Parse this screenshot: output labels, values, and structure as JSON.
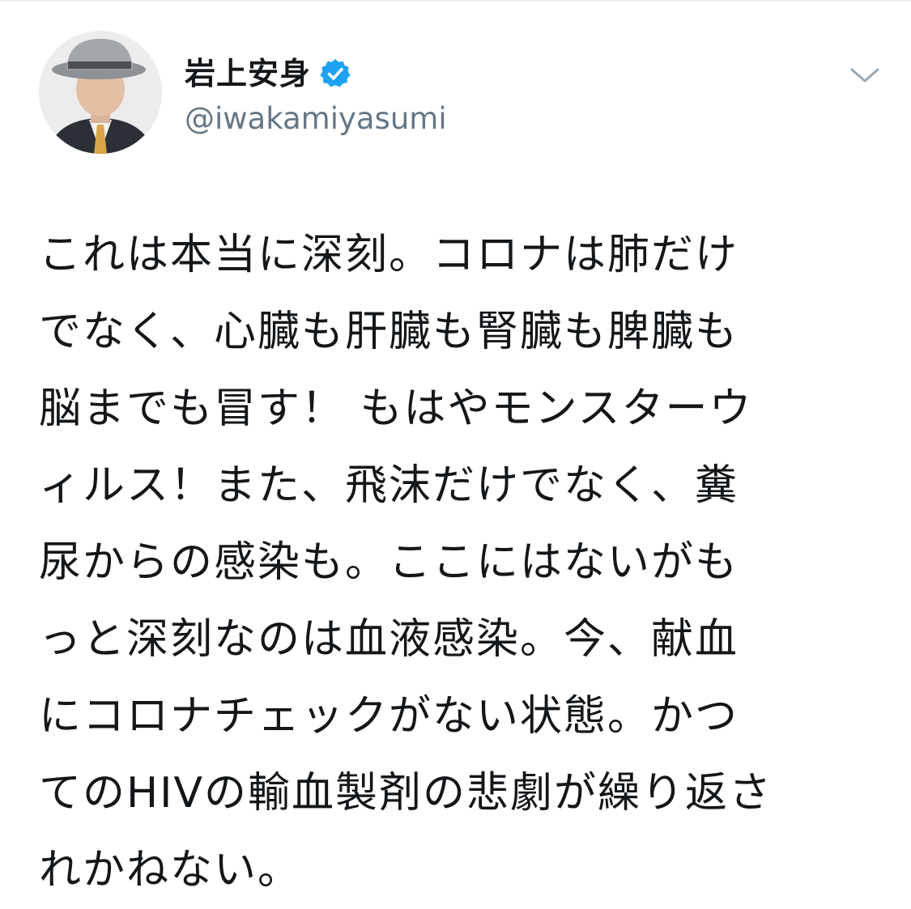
{
  "header": {
    "display_name": "岩上安身",
    "handle": "@iwakamiyasumi",
    "verified": true,
    "icons": {
      "verified": "verified-badge-icon",
      "menu": "chevron-down-icon"
    }
  },
  "tweet": {
    "lines": [
      "これは本当に深刻。コロナは肺だけ",
      "でなく、心臓も肝臓も腎臓も脾臓も",
      "脳までも冒す！ もはやモンスターウ",
      "ィルス！また、飛沫だけでなく、糞",
      "尿からの感染も。ここにはないがも",
      "っと深刻なのは血液感染。今、献血",
      "にコロナチェックがない状態。かつ",
      "てのHIVの輸血製剤の悲劇が繰り返さ",
      "れかねない。"
    ]
  },
  "colors": {
    "verified_blue": "#1da1f2",
    "text": "#14171a",
    "secondary": "#657786",
    "divider": "#e6ecf0"
  }
}
